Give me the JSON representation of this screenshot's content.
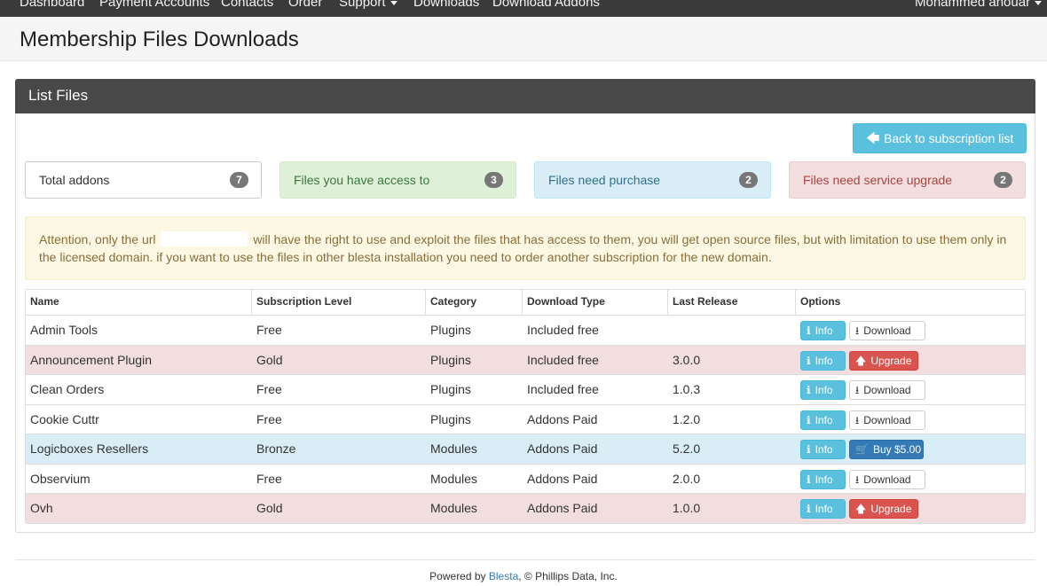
{
  "nav": {
    "items": [
      "Dashboard",
      "Payment Accounts",
      "Contacts",
      "Order",
      "Support",
      "Downloads",
      "Download Addons"
    ],
    "user": "Mohammed anouar"
  },
  "header": {
    "title": "Membership Files Downloads"
  },
  "panel": {
    "title": "List Files",
    "back_label": "Back to subscription list",
    "stats": [
      {
        "label": "Total addons",
        "count": "7"
      },
      {
        "label": "Files you have access to",
        "count": "3"
      },
      {
        "label": "Files need purchase",
        "count": "2"
      },
      {
        "label": "Files need service upgrade",
        "count": "2"
      }
    ],
    "alert": {
      "before": "Attention, only the url",
      "after": "will have the right to use and exploit the files that has access to them, you will get open source files, but with limitation to use them only in the licensed domain. if you want to use the files in other blesta installation you need to order another subscription for the new domain."
    }
  },
  "table": {
    "columns": [
      "Name",
      "Subscription Level",
      "Category",
      "Download Type",
      "Last Release",
      "Options"
    ],
    "rows": [
      {
        "name": "Admin Tools",
        "level": "Free",
        "category": "Plugins",
        "type": "Included free",
        "release": "",
        "info": "Info",
        "action": "Download"
      },
      {
        "name": "Announcement Plugin",
        "level": "Gold",
        "category": "Plugins",
        "type": "Included free",
        "release": "3.0.0",
        "info": "Info",
        "action": "Upgrade"
      },
      {
        "name": "Clean Orders",
        "level": "Free",
        "category": "Plugins",
        "type": "Included free",
        "release": "1.0.3",
        "info": "Info",
        "action": "Download"
      },
      {
        "name": "Cookie Cuttr",
        "level": "Free",
        "category": "Plugins",
        "type": "Addons Paid",
        "release": "1.2.0",
        "info": "Info",
        "action": "Download"
      },
      {
        "name": "Logicboxes Resellers",
        "level": "Bronze",
        "category": "Modules",
        "type": "Addons Paid",
        "release": "5.2.0",
        "info": "Info",
        "action": "Buy $5.00"
      },
      {
        "name": "Observium",
        "level": "Free",
        "category": "Modules",
        "type": "Addons Paid",
        "release": "2.0.0",
        "info": "Info",
        "action": "Download"
      },
      {
        "name": "Ovh",
        "level": "Gold",
        "category": "Modules",
        "type": "Addons Paid",
        "release": "1.0.0",
        "info": "Info",
        "action": "Upgrade"
      }
    ]
  },
  "footer": {
    "prefix": "Powered by",
    "link": "Blesta",
    "suffix": ", © Phillips Data, Inc."
  }
}
